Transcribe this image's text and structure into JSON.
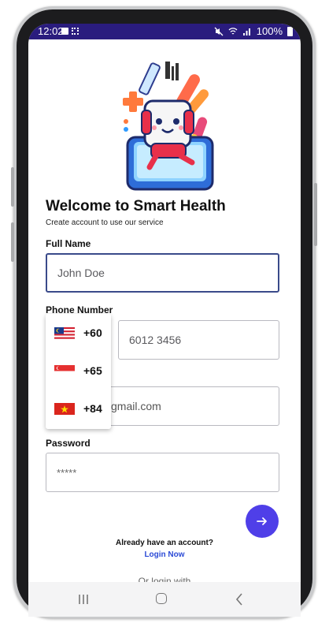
{
  "status_bar": {
    "time": "12:02",
    "battery": "100%"
  },
  "header": {
    "title": "Welcome to Smart Health",
    "subtitle": "Create account to use our service"
  },
  "form": {
    "full_name_label": "Full Name",
    "full_name_placeholder": "John Doe",
    "phone_label": "Phone Number",
    "phone_placeholder": "6012 3456",
    "email_partial_text": "gmail.com",
    "password_label": "Password",
    "password_value": "*****"
  },
  "country_dropdown": {
    "options": [
      {
        "flag": "malaysia-flag-icon",
        "code": "+60"
      },
      {
        "flag": "singapore-flag-icon",
        "code": "+65"
      },
      {
        "flag": "vietnam-flag-icon",
        "code": "+84"
      }
    ]
  },
  "footer": {
    "have_account": "Already have an account?",
    "login_now": "Login Now",
    "or_login_with": "Or login with"
  },
  "colors": {
    "status_bar": "#2a1c7e",
    "accent_button": "#4f3fe8",
    "link": "#2b4ad6",
    "focus_border": "#3a4a8a"
  }
}
